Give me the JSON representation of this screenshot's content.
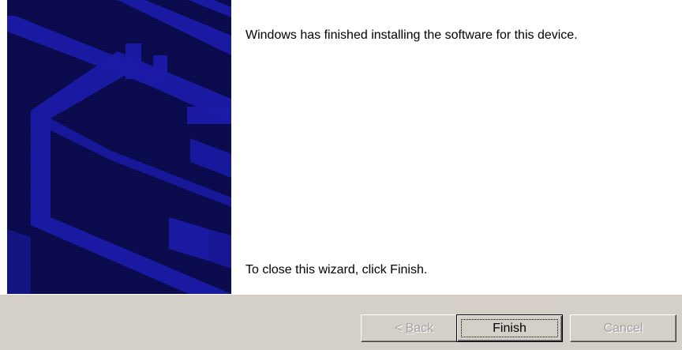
{
  "wizard": {
    "message": "Windows has finished installing the software for this device.",
    "close_hint": "To close this wizard, click Finish."
  },
  "buttons": {
    "back": {
      "prefix": "< ",
      "accel": "B",
      "rest": "ack",
      "enabled": false
    },
    "finish": {
      "label": "Finish",
      "enabled": true,
      "default": true
    },
    "cancel": {
      "label": "Cancel",
      "enabled": false
    }
  },
  "colors": {
    "banner_bg": "#0a0a4a",
    "banner_shape": "#1a1aa6",
    "dialog_face": "#d4d0c8",
    "disabled_text": "#a0a0a0"
  },
  "icons": {
    "banner": "hardware-wizard-banner"
  }
}
